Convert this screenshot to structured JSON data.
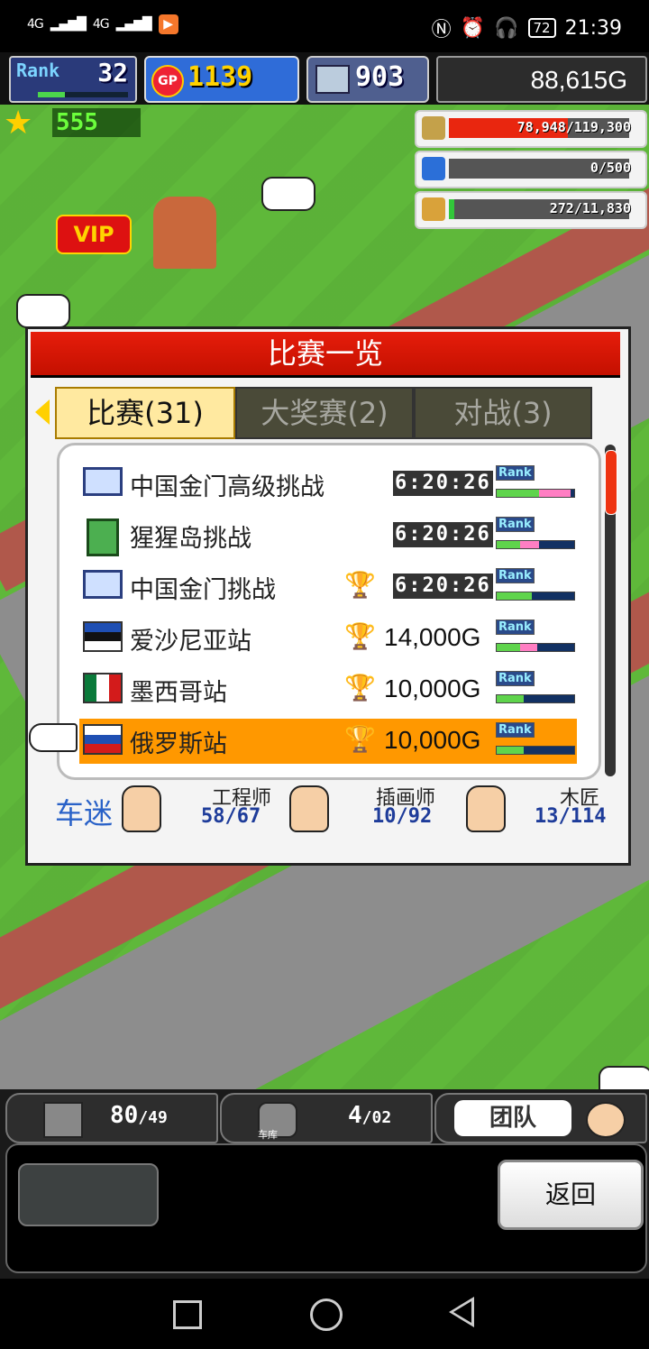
{
  "status_bar": {
    "signal_left": "4G",
    "signal_right": "4G",
    "battery": "72",
    "time": "21:39"
  },
  "hud": {
    "rank_label": "Rank",
    "rank_value": "32",
    "gp_icon": "GP",
    "gp_value": "1139",
    "pc_value": "903",
    "money": "88,615G",
    "star_value": "555",
    "meters": [
      {
        "icon": "coin-stack-icon",
        "text": "78,948/119,300",
        "fill": 0.66,
        "color": "#e9260f"
      },
      {
        "icon": "bottle-icon",
        "text": "0/500",
        "fill": 0.0,
        "color": "#2b9fe8"
      },
      {
        "icon": "wheat-icon",
        "text": "272/11,830",
        "fill": 0.03,
        "color": "#32c83a"
      }
    ],
    "vip_text": "VIP"
  },
  "modal": {
    "title": "比赛一览",
    "tabs": [
      {
        "label": "比赛(31)",
        "active": true
      },
      {
        "label": "大奖赛(2)",
        "active": false
      },
      {
        "label": "对战(3)",
        "active": false
      }
    ],
    "rank_mini_label": "Rank",
    "races": [
      {
        "name": "中国金门高级挑战",
        "icon": "computer-icon",
        "trophy": false,
        "timer": "6:20:26",
        "prize": "",
        "rank_green": 0.55,
        "rank_pink": 0.4,
        "selected": false
      },
      {
        "name": "猩猩岛挑战",
        "icon": "green-book-icon",
        "trophy": false,
        "timer": "6:20:26",
        "prize": "",
        "rank_green": 0.3,
        "rank_pink": 0.25,
        "selected": false
      },
      {
        "name": "中国金门挑战",
        "icon": "computer-icon",
        "trophy": true,
        "timer": "6:20:26",
        "prize": "",
        "rank_green": 0.45,
        "rank_pink": 0.0,
        "selected": false
      },
      {
        "name": "爱沙尼亚站",
        "icon": "estonia-flag-icon",
        "trophy": true,
        "timer": "",
        "prize": "14,000G",
        "rank_green": 0.3,
        "rank_pink": 0.22,
        "selected": false
      },
      {
        "name": "墨西哥站",
        "icon": "mexico-flag-icon",
        "trophy": true,
        "timer": "",
        "prize": "10,000G",
        "rank_green": 0.35,
        "rank_pink": 0.0,
        "selected": false
      },
      {
        "name": "俄罗斯站",
        "icon": "russia-flag-icon",
        "trophy": true,
        "timer": "",
        "prize": "10,000G",
        "rank_green": 0.35,
        "rank_pink": 0.0,
        "selected": true
      }
    ],
    "staff": {
      "fan_label": "车迷",
      "members": [
        {
          "role": "工程师",
          "count": "58/67"
        },
        {
          "role": "插画师",
          "count": "10/92"
        },
        {
          "role": "木匠",
          "count": "13/114"
        }
      ]
    }
  },
  "bottom_hud": {
    "slot1_value": "80",
    "slot1_max": "/49",
    "slot2_caption": "车库",
    "slot2_value": "4",
    "slot2_max": "/02",
    "team_label": "团队",
    "back_label": "返回"
  }
}
